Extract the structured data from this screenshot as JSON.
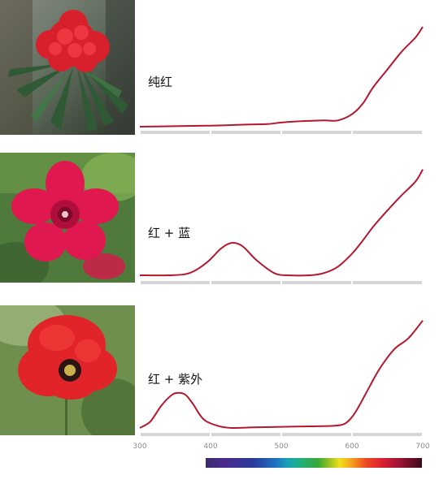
{
  "panels": [
    {
      "label": "纯红",
      "photo_subject": "red rhododendron flower cluster"
    },
    {
      "label": "红 + 蓝",
      "photo_subject": "magenta-pink dianthus flower"
    },
    {
      "label": "红 + 紫外",
      "photo_subject": "red poppy flower"
    }
  ],
  "colors": {
    "curve": "#b5172e",
    "axis": "#d6d6d6",
    "tick_text": "#8a8a8a"
  },
  "chart_data": [
    {
      "type": "line",
      "title": "",
      "label": "纯红",
      "xlim": [
        300,
        700
      ],
      "x": [
        300,
        350,
        400,
        450,
        480,
        500,
        520,
        560,
        580,
        600,
        615,
        630,
        650,
        670,
        690,
        700
      ],
      "y": [
        0.0,
        0.005,
        0.01,
        0.02,
        0.025,
        0.04,
        0.05,
        0.06,
        0.06,
        0.12,
        0.22,
        0.38,
        0.55,
        0.72,
        0.86,
        0.96
      ]
    },
    {
      "type": "line",
      "title": "",
      "label": "红 + 蓝",
      "xlim": [
        300,
        700
      ],
      "x": [
        300,
        340,
        370,
        395,
        415,
        430,
        445,
        465,
        490,
        510,
        540,
        560,
        580,
        600,
        615,
        630,
        650,
        670,
        690,
        700
      ],
      "y": [
        0.0,
        0.0,
        0.02,
        0.12,
        0.25,
        0.3,
        0.27,
        0.14,
        0.02,
        0.0,
        0.0,
        0.02,
        0.08,
        0.2,
        0.32,
        0.45,
        0.6,
        0.74,
        0.87,
        0.98
      ]
    },
    {
      "type": "line",
      "title": "",
      "label": "红 + 紫外",
      "xlim": [
        300,
        700
      ],
      "x": [
        300,
        315,
        330,
        345,
        355,
        365,
        375,
        390,
        410,
        430,
        460,
        500,
        540,
        575,
        590,
        600,
        610,
        625,
        640,
        660,
        680,
        700
      ],
      "y": [
        0.0,
        0.06,
        0.2,
        0.3,
        0.32,
        0.3,
        0.22,
        0.08,
        0.02,
        0.0,
        0.005,
        0.01,
        0.015,
        0.02,
        0.04,
        0.1,
        0.2,
        0.38,
        0.55,
        0.72,
        0.82,
        0.98
      ]
    }
  ],
  "x_axis": {
    "ticks": [
      300,
      400,
      500,
      600,
      700
    ]
  },
  "spectrum_bar": {
    "range_nm": [
      400,
      700
    ]
  }
}
